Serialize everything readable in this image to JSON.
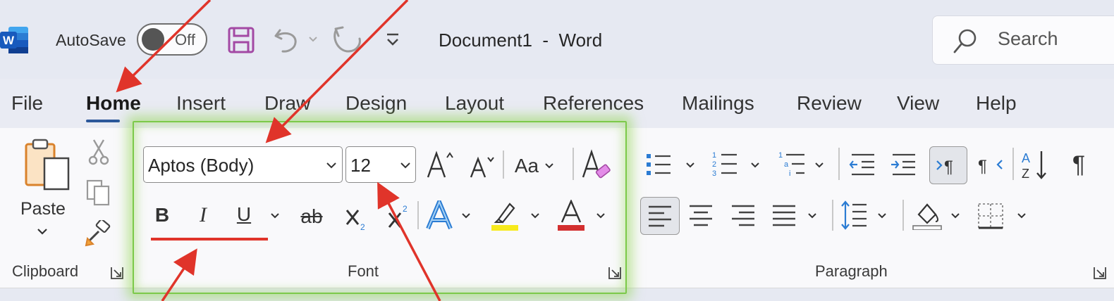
{
  "titlebar": {
    "autosave_label": "AutoSave",
    "autosave_state": "Off",
    "doc_title": "Document1  -  Word",
    "search_label": "Search",
    "accent": "#2b579a",
    "save_icon_color": "#a349a4"
  },
  "tabs": [
    "File",
    "Home",
    "Insert",
    "Draw",
    "Design",
    "Layout",
    "References",
    "Mailings",
    "Review",
    "View",
    "Help"
  ],
  "active_tab": "Home",
  "clipboard": {
    "paste_label": "Paste",
    "group_label": "Clipboard"
  },
  "font": {
    "font_name": "Aptos (Body)",
    "font_size": "12",
    "change_case_label": "Aa",
    "group_label": "Font",
    "highlight_color": "#f7ea1c",
    "font_color": "#d32f2f"
  },
  "paragraph": {
    "group_label": "Paragraph"
  },
  "annotations": {
    "arrow_color": "#e0342a",
    "glow_color": "#8fd45a"
  }
}
